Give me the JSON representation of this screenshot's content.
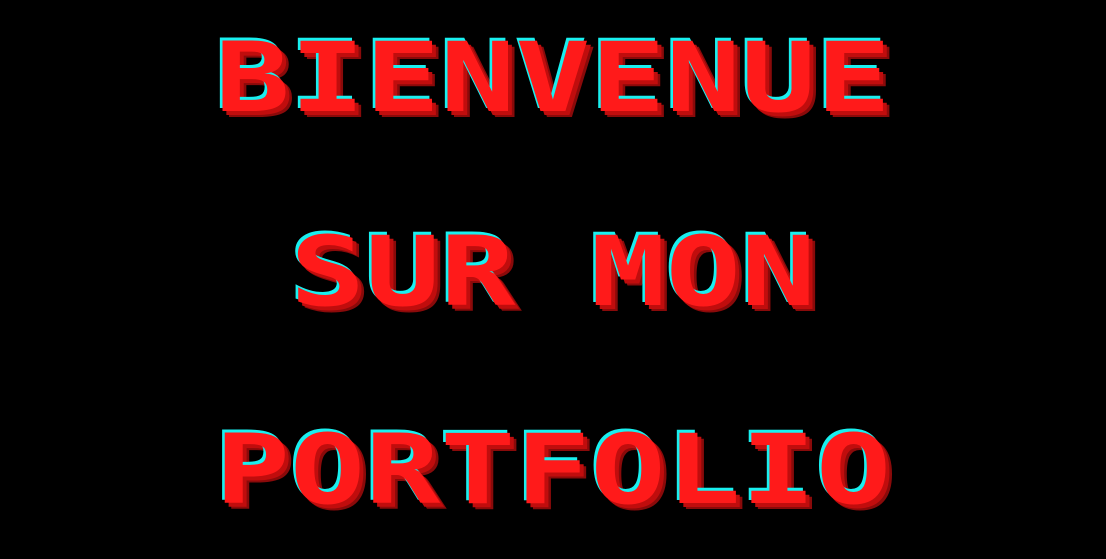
{
  "hero": {
    "lines": [
      "BIENVENUE",
      "SUR MON",
      "PORTFOLIO"
    ]
  },
  "colors": {
    "background": "#000000",
    "text": "#ff1a1a",
    "highlight": "#19f0f0",
    "shadow": "#c00d0d"
  }
}
